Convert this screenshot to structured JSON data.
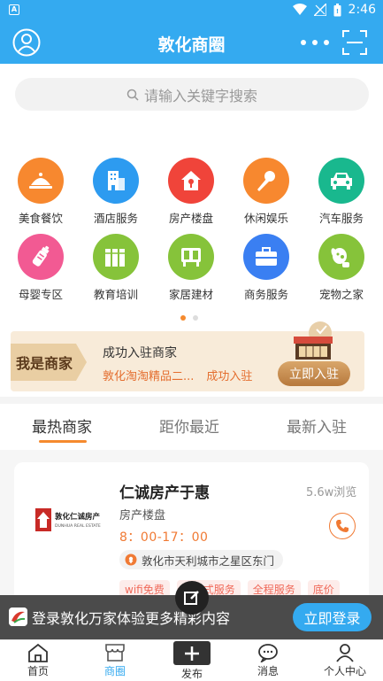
{
  "status_bar": {
    "time": "2:46"
  },
  "header": {
    "title": "敦化商圈"
  },
  "search": {
    "placeholder": "请输入关键字搜索"
  },
  "categories": [
    {
      "label": "美食餐饮",
      "icon": "food-cover-icon",
      "color": "#f7882f"
    },
    {
      "label": "酒店服务",
      "icon": "hotel-building-icon",
      "color": "#2d9bf0"
    },
    {
      "label": "房产楼盘",
      "icon": "house-icon",
      "color": "#f0443a"
    },
    {
      "label": "休闲娱乐",
      "icon": "microphone-icon",
      "color": "#f7882f"
    },
    {
      "label": "汽车服务",
      "icon": "car-icon",
      "color": "#19b88e"
    },
    {
      "label": "母婴专区",
      "icon": "baby-bottle-icon",
      "color": "#f25a93"
    },
    {
      "label": "教育培训",
      "icon": "books-icon",
      "color": "#86c33a"
    },
    {
      "label": "家居建材",
      "icon": "furniture-icon",
      "color": "#86c33a"
    },
    {
      "label": "商务服务",
      "icon": "briefcase-icon",
      "color": "#3a7ff2"
    },
    {
      "label": "宠物之家",
      "icon": "dog-icon",
      "color": "#86c33a"
    }
  ],
  "merchant_promo": {
    "tag": "我是商家",
    "title": "成功入驻商家",
    "recent_shop": "敦化淘淘精品二...",
    "recent_status": "成功入驻",
    "join_button": "立即入驻"
  },
  "list_tabs": [
    {
      "label": "最热商家",
      "active": true
    },
    {
      "label": "距你最近",
      "active": false
    },
    {
      "label": "最新入驻",
      "active": false
    }
  ],
  "shop": {
    "name": "仁诚房产于惠",
    "views": "5.6w浏览",
    "category": "房产楼盘",
    "hours": "8：00-17：00",
    "address": "敦化市天利城市之星区东门",
    "logo_text": "敦化仁诚房产",
    "logo_sub": "DUNHUA REAL ESTATE",
    "tags": [
      "wifi免费",
      "一站式服务",
      "全程服务",
      "底价"
    ]
  },
  "login_prompt": {
    "text": "登录敦化万家体验更多精彩内容",
    "button": "立即登录"
  },
  "bottom_nav": {
    "home": "首页",
    "circle": "商圈",
    "publish": "发布",
    "messages": "消息",
    "profile": "个人中心"
  },
  "colors": {
    "primary": "#34aaf0",
    "accent": "#f07a34",
    "promo_bg": "#f8ebd9"
  }
}
